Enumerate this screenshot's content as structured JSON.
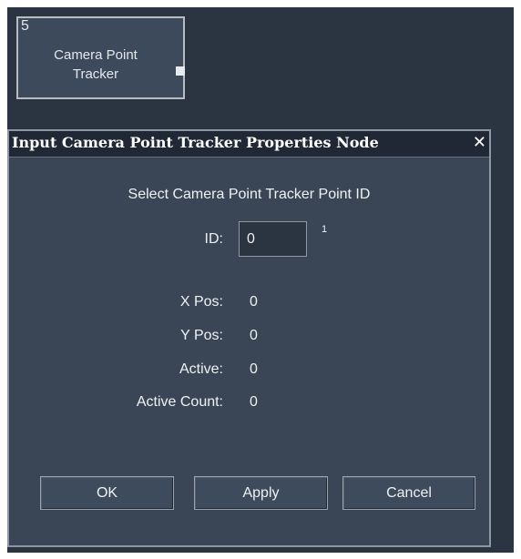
{
  "node": {
    "number": "5",
    "title_line1": "Camera Point",
    "title_line2": "Tracker"
  },
  "dialog": {
    "title": "Input Camera Point Tracker Properties Node",
    "close_symbol": "✕",
    "prompt": "Select Camera Point Tracker Point ID",
    "id_label": "ID:",
    "id_value": "0",
    "id_superscript": "1",
    "fields": [
      {
        "label": "X Pos:",
        "value": "0"
      },
      {
        "label": "Y Pos:",
        "value": "0"
      },
      {
        "label": "Active:",
        "value": "0"
      },
      {
        "label": "Active Count:",
        "value": "0"
      }
    ],
    "buttons": {
      "ok": "OK",
      "apply": "Apply",
      "cancel": "Cancel"
    }
  }
}
